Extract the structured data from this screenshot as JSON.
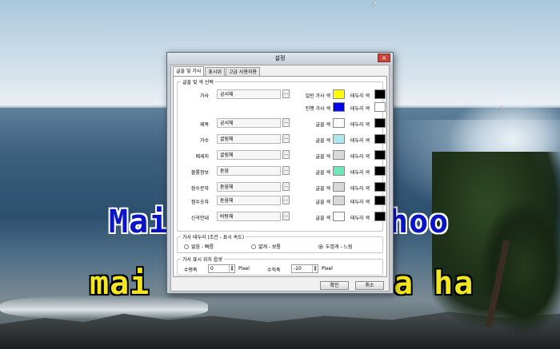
{
  "desktop": {
    "karaoke_line1_left": "Mai",
    "karaoke_line1_right": "hoo",
    "karaoke_line2_left": "mai",
    "karaoke_line2_right": "a ha"
  },
  "dialog": {
    "title": "설정",
    "close_label": "×",
    "tabs": [
      {
        "label": "글꼴 및 가사"
      },
      {
        "label": "표시위"
      },
      {
        "label": "고급 사용자용"
      }
    ],
    "font_group_title": "글꼴 및 색 선택",
    "font_rows": [
      {
        "label": "가사",
        "font": "궁서체",
        "color_label": "일반 가사 색",
        "color": "#ffff00",
        "outline_label": "테두리 색",
        "outline_color": "#000000"
      },
      {
        "label": "",
        "font": "",
        "color_label": "진행 가사 색",
        "color": "#0000ee",
        "outline_label": "테두리 색",
        "outline_color": "#ffffff"
      },
      {
        "label": "제목",
        "font": "궁서체",
        "color_label": "글꼴 색",
        "color": "#ffffff",
        "outline_label": "테두리 색",
        "outline_color": "#000000"
      },
      {
        "label": "가수",
        "font": "굴림체",
        "color_label": "글꼴 색",
        "color": "#aee8ec",
        "outline_label": "테두리 색",
        "outline_color": "#000000"
      },
      {
        "label": "메세지",
        "font": "굴림체",
        "color_label": "글꼴 색",
        "color": "#d8d8d8",
        "outline_label": "테두리 색",
        "outline_color": "#000000"
      },
      {
        "label": "볼륨정보",
        "font": "돋움",
        "color_label": "글꼴 색",
        "color": "#6ee8b8",
        "outline_label": "테두리 색",
        "outline_color": "#000000"
      },
      {
        "label": "점수문자",
        "font": "돋움체",
        "color_label": "글꼴 색",
        "color": "#d8d8d8",
        "outline_label": "테두리 색",
        "outline_color": "#000000"
      },
      {
        "label": "점수숫자",
        "font": "돋움체",
        "color_label": "글꼴 색",
        "color": "#d8d8d8",
        "outline_label": "테두리 색",
        "outline_color": "#000000"
      },
      {
        "label": "신곡안내",
        "font": "바탕체",
        "color_label": "글꼴 색",
        "color": "#ffffff",
        "outline_label": "테두리 색",
        "outline_color": "#000000"
      }
    ],
    "dots_label": "...",
    "speed_group_title": "가사 테두리 (조건 - 표시 속도)",
    "speed_options": [
      {
        "label": "없음 - 빠름",
        "selected": false
      },
      {
        "label": "얇게 - 보통",
        "selected": false
      },
      {
        "label": "두껍게 - 느림",
        "selected": true
      }
    ],
    "position_group_title": "가사 표시 위치 옵셋",
    "horizontal_label": "수평축",
    "horizontal_value": "0",
    "vertical_label": "수직축",
    "vertical_value": "-10",
    "unit": "Pixel",
    "ok_label": "확인",
    "cancel_label": "취소"
  }
}
